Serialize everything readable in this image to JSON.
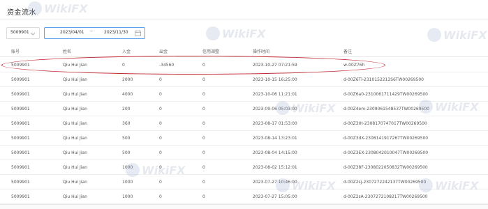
{
  "page": {
    "title": "资金流水"
  },
  "filters": {
    "account_value": "5009901",
    "date_start": "2023/04/01",
    "date_separator": "~",
    "date_end": "2023/11/30"
  },
  "table": {
    "headers": {
      "account": "账号",
      "name": "姓名",
      "deposit": "入金",
      "withdraw": "出金",
      "credit": "信用调整",
      "time": "操作时间",
      "note": "备注"
    },
    "rows": [
      {
        "account": "5009901",
        "name": "Qiu Hui Jian",
        "deposit": "0",
        "withdraw": "-34560",
        "credit": "0",
        "time": "2023-10-27 07:21:59",
        "note": "w-00Z76h"
      },
      {
        "account": "5009901",
        "name": "Qiu Hui Jian",
        "deposit": "2000",
        "withdraw": "0",
        "credit": "0",
        "time": "2023-10-15 16:25:00",
        "note": "d-00Z6Tl-2310152213S6TW00269500"
      },
      {
        "account": "5009901",
        "name": "Qiu Hui Jian",
        "deposit": "4000",
        "withdraw": "0",
        "credit": "0",
        "time": "2023-10-06 11:21:01",
        "note": "d-00Z6a0-2310061711429TW00269500"
      },
      {
        "account": "5009901",
        "name": "Qiu Hui Jian",
        "deposit": "200",
        "withdraw": "0",
        "credit": "0",
        "time": "2023-09-06 05:03:00",
        "note": "d-00Z4em-2309061548537TW00269500"
      },
      {
        "account": "5009901",
        "name": "Qiu Hui Jian",
        "deposit": "360",
        "withdraw": "0",
        "credit": "0",
        "time": "2023-08-17 01:53:00",
        "note": "d-00Z3IH-2308170747017TW00269500"
      },
      {
        "account": "5009901",
        "name": "Qiu Hui Jian",
        "deposit": "500",
        "withdraw": "0",
        "credit": "0",
        "time": "2023-08-14 13:23:01",
        "note": "d-00Z3dX-2308141917267TW00269500"
      },
      {
        "account": "5009901",
        "name": "Qiu Hui Jian",
        "deposit": "500",
        "withdraw": "0",
        "credit": "0",
        "time": "2023-08-04 14:15:00",
        "note": "d-00Z3EX-2308042010047TW00269500"
      },
      {
        "account": "5009901",
        "name": "Qiu Hui Jian",
        "deposit": "1000",
        "withdraw": "0",
        "credit": "0",
        "time": "2023-08-02 15:12:01",
        "note": "d-00Z38F-2308022050832TW00269500"
      },
      {
        "account": "5009901",
        "name": "Qiu Hui Jian",
        "deposit": "1000",
        "withdraw": "0",
        "credit": "0",
        "time": "2023-07-27 10:46:00",
        "note": "d-00Z2sj-2307272242137TW00269500"
      },
      {
        "account": "5009901",
        "name": "Qiu Hui Jian",
        "deposit": "1000",
        "withdraw": "0",
        "credit": "0",
        "time": "2023-07-27 15:05:00",
        "note": "d-00Z2sA-2307272108217TW00269500"
      }
    ]
  },
  "watermark": {
    "text": "WikiFX"
  },
  "colors": {
    "highlight": "#c0262d",
    "focus_border": "#5ba3e8"
  },
  "icons": {
    "select": "chevron-down-icon",
    "date": "calendar-icon",
    "watermark": "wikifx-logo-icon"
  }
}
